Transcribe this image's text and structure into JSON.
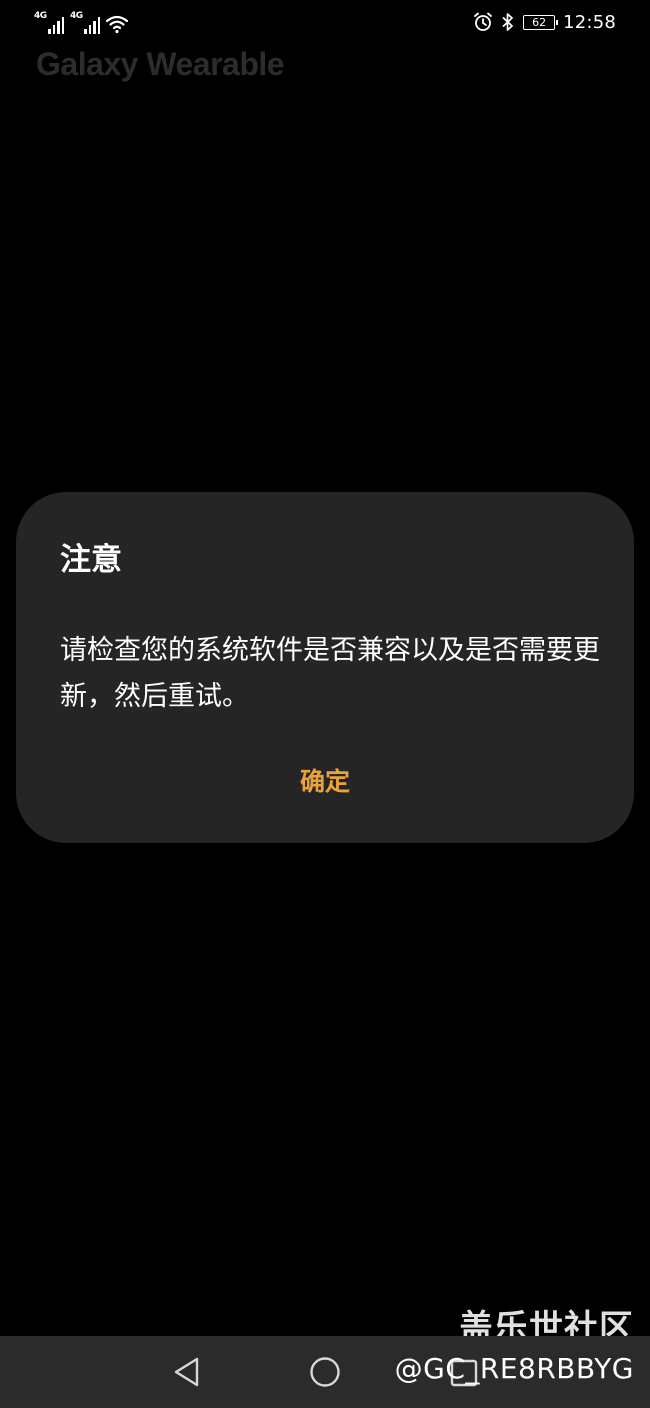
{
  "status_bar": {
    "network_1": "4G",
    "network_2": "4G",
    "battery_level": "62",
    "time": "12:58",
    "icons": [
      "signal-icon",
      "signal-icon",
      "wifi-icon",
      "alarm-icon",
      "bluetooth-icon",
      "battery-icon"
    ]
  },
  "app": {
    "title": "Galaxy Wearable"
  },
  "dialog": {
    "title": "注意",
    "message": "请检查您的系统软件是否兼容以及是否需要更新，然后重试。",
    "ok_label": "确定"
  },
  "watermark": {
    "site": "盖乐世社区",
    "user": "@GC_RE8RBBYG"
  },
  "navigation": {
    "icons": [
      "back-icon",
      "home-icon",
      "recents-icon"
    ]
  },
  "colors": {
    "background": "#000000",
    "dialog_background": "#252525",
    "accent": "#e8a33c",
    "nav_background": "#2b2b2b"
  }
}
